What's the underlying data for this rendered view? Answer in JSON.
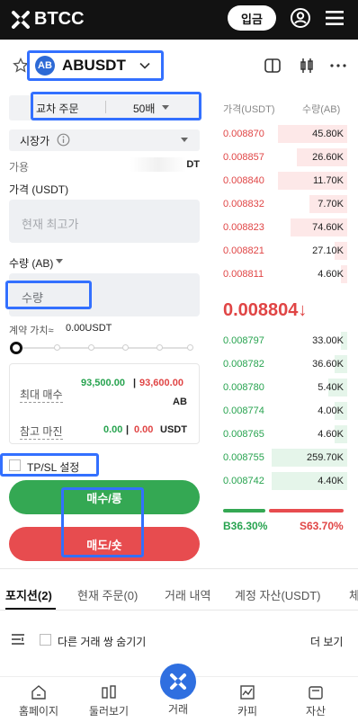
{
  "header": {
    "brand": "BTCC",
    "login_label": "입금"
  },
  "symbol": {
    "coin_badge": "AB",
    "name": "ABUSDT"
  },
  "order_form": {
    "margin_mode": "교차 주문",
    "leverage": "50배",
    "order_type": "시장가",
    "available_label": "가용",
    "available_unit": "DT",
    "price_label": "가격 (USDT)",
    "price_placeholder": "현재 최고가",
    "qty_label": "수량 (AB)",
    "qty_placeholder": "수량",
    "contract_label": "계약 가치≈",
    "contract_value": "0.00USDT",
    "max_buy_label": "최대 매수",
    "max_buy_long": "93,500.00",
    "max_buy_sep": "|",
    "max_buy_short": "93,600.00",
    "max_buy_unit": "AB",
    "ref_margin_label": "참고 마진",
    "ref_margin_long": "0.00",
    "ref_margin_sep": "|",
    "ref_margin_short": "0.00",
    "ref_margin_unit": "USDT",
    "tpsl_label": "TP/SL 설정",
    "buy_label": "매수/롱",
    "sell_label": "매도/숏"
  },
  "order_book": {
    "price_header": "가격(USDT)",
    "qty_header": "수량(AB)",
    "asks": [
      {
        "price": "0.008870",
        "qty": "45.80K",
        "depth": 0.55
      },
      {
        "price": "0.008857",
        "qty": "26.60K",
        "depth": 0.4
      },
      {
        "price": "0.008840",
        "qty": "11.70K",
        "depth": 0.55
      },
      {
        "price": "0.008832",
        "qty": "7.70K",
        "depth": 0.3
      },
      {
        "price": "0.008823",
        "qty": "74.60K",
        "depth": 0.45
      },
      {
        "price": "0.008821",
        "qty": "27.10K",
        "depth": 0.1
      },
      {
        "price": "0.008811",
        "qty": "4.60K",
        "depth": 0.05
      }
    ],
    "last_price": "0.008804",
    "last_arrow": "↓",
    "bids": [
      {
        "price": "0.008797",
        "qty": "33.00K",
        "depth": 0.05
      },
      {
        "price": "0.008782",
        "qty": "36.60K",
        "depth": 0.1
      },
      {
        "price": "0.008780",
        "qty": "5.40K",
        "depth": 0.15
      },
      {
        "price": "0.008774",
        "qty": "4.00K",
        "depth": 0.1
      },
      {
        "price": "0.008765",
        "qty": "4.60K",
        "depth": 0.1
      },
      {
        "price": "0.008755",
        "qty": "259.70K",
        "depth": 0.6
      },
      {
        "price": "0.008742",
        "qty": "4.40K",
        "depth": 0.6
      }
    ],
    "buy_ratio": "B36.30%",
    "sell_ratio": "S63.70%",
    "buy_fraction": 0.363
  },
  "tabs": {
    "positions": "포지션(2)",
    "open_orders": "현재 주문(0)",
    "history": "거래 내역",
    "assets": "계정 자산(USDT)",
    "more": "체"
  },
  "list_controls": {
    "hide_others": "다른 거래 쌍 숨기기",
    "more": "더 보기"
  },
  "bottom_nav": {
    "home": "홈페이지",
    "markets": "둘러보기",
    "trade": "거래",
    "copy": "카피",
    "assets": "자산"
  },
  "colors": {
    "brand_blue": "#2f6fe0",
    "highlight_blue": "#3370ff",
    "buy_green": "#34a853",
    "sell_red": "#e74c4f"
  }
}
